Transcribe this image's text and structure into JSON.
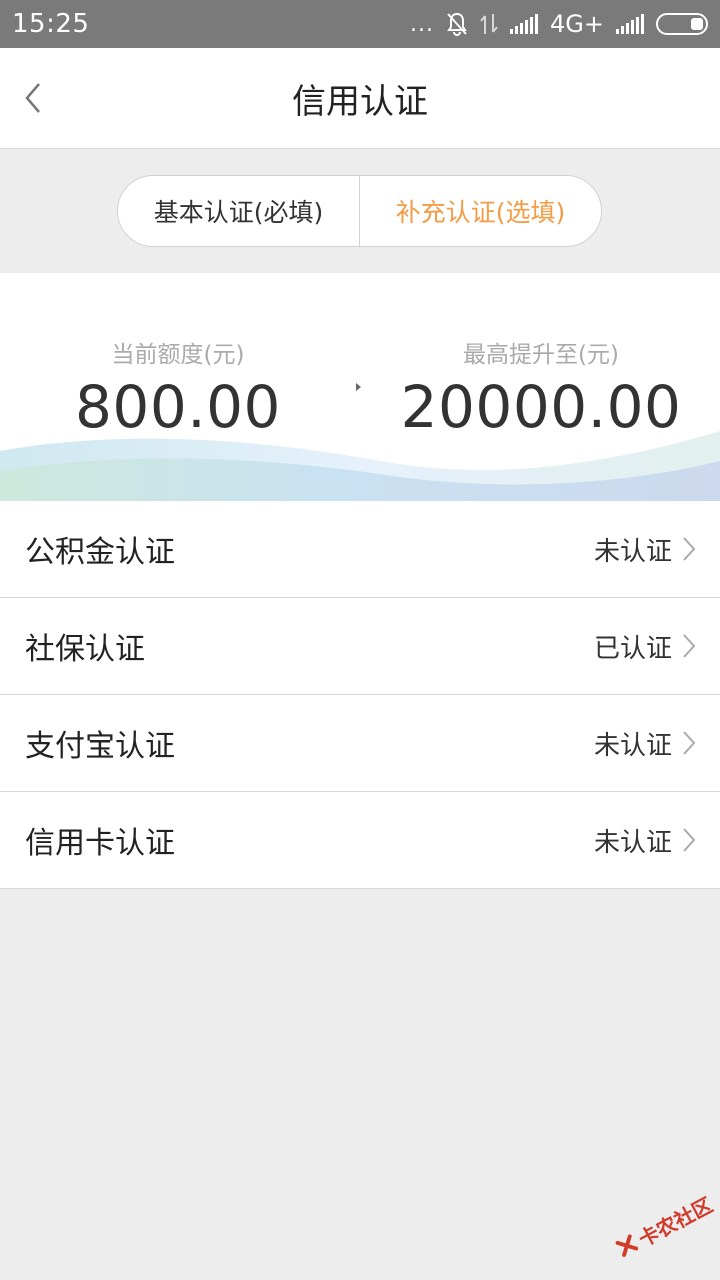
{
  "status_bar": {
    "time": "15:25",
    "dots": "...",
    "network": "4G+"
  },
  "header": {
    "title": "信用认证",
    "back_icon": "chevron-left-icon"
  },
  "tabs": [
    {
      "label": "基本认证(必填)",
      "active": false
    },
    {
      "label": "补充认证(选填)",
      "active": true
    }
  ],
  "quota": {
    "current_label": "当前额度(元)",
    "current_value": "800.00",
    "max_label": "最高提升至(元)",
    "max_value": "20000.00"
  },
  "items": [
    {
      "label": "公积金认证",
      "status": "未认证"
    },
    {
      "label": "社保认证",
      "status": "已认证"
    },
    {
      "label": "支付宝认证",
      "status": "未认证"
    },
    {
      "label": "信用卡认证",
      "status": "未认证"
    }
  ],
  "watermark": {
    "text": "卡农社区"
  },
  "colors": {
    "accent": "#f39c45",
    "status_bar": "#7a7a7a",
    "background": "#ededed"
  }
}
